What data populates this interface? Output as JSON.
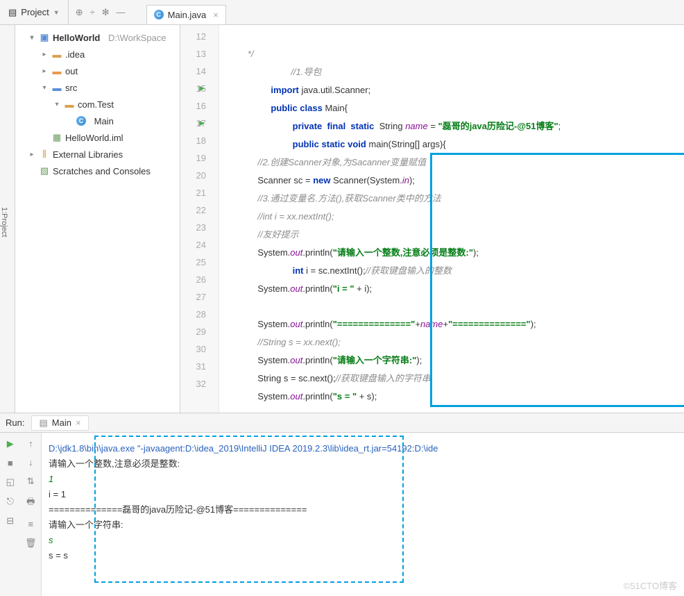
{
  "toolbar": {
    "project_label": "Project",
    "file_tab": "Main.java"
  },
  "tree": {
    "root": "HelloWorld",
    "root_path": "D:\\WorkSpace",
    "idea": ".idea",
    "out": "out",
    "src": "src",
    "pkg": "com.Test",
    "main": "Main",
    "iml": "HelloWorld.iml",
    "ext": "External Libraries",
    "scratch": "Scratches and Consoles"
  },
  "code": {
    "lines": [
      "12",
      "13",
      "14",
      "15",
      "16",
      "17",
      "18",
      "19",
      "20",
      "21",
      "22",
      "23",
      "24",
      "25",
      "26",
      "27",
      "28",
      "29",
      "30",
      "31",
      "32"
    ],
    "l12": "        */",
    "l13": "        //1.导包",
    "l14_a": "import",
    "l14_b": " java.util.Scanner;",
    "l15_a": "public class",
    "l15_b": " Main{",
    "l16_a": "private  final  static",
    "l16_b": "  String ",
    "l16_c": "name",
    "l16_d": " = ",
    "l16_e": "\"磊哥的java历险记-@51博客\"",
    "l16_f": ";",
    "l17_a": "public static void",
    "l17_b": " main(String[] args){",
    "l18": "            //2.创建Scanner对象,为Sacanner变量赋值",
    "l19_a": "            Scanner sc = ",
    "l19_b": "new",
    "l19_c": " Scanner(System.",
    "l19_d": "in",
    "l19_e": ");",
    "l20": "            //3.通过变量名.方法(),获取Scanner类中的方法",
    "l21": "            //int i = xx.nextInt();",
    "l22": "            //友好提示",
    "l23_a": "            System.",
    "l23_b": "out",
    "l23_c": ".println(",
    "l23_d": "\"请输入一个整数,注意必须是整数:\"",
    "l23_e": ");",
    "l24_a": "int",
    "l24_b": " i = sc.nextInt();",
    "l24_c": "//获取键盘输入的整数",
    "l25_a": "            System.",
    "l25_b": "out",
    "l25_c": ".println(",
    "l25_d": "\"i = \"",
    "l25_e": " + i);",
    "l27_a": "            System.",
    "l27_b": "out",
    "l27_c": ".println(",
    "l27_d": "\"==============\"",
    "l27_e": "+",
    "l27_f": "name",
    "l27_g": "+",
    "l27_h": "\"==============\"",
    "l27_i": ");",
    "l28": "            //String s = xx.next();",
    "l29_a": "            System.",
    "l29_b": "out",
    "l29_c": ".println(",
    "l29_d": "\"请输入一个字符串:\"",
    "l29_e": ");",
    "l30_a": "            String s = sc.next();",
    "l30_b": "//获取键盘输入的字符串",
    "l31_a": "            System.",
    "l31_b": "out",
    "l31_c": ".println(",
    "l31_d": "\"s = \"",
    "l31_e": " + s);"
  },
  "run": {
    "label": "Run:",
    "tab": "Main",
    "cmd": "D:\\jdk1.8\\bin\\java.exe \"-javaagent:D:\\idea_2019\\IntelliJ IDEA 2019.2.3\\lib\\idea_rt.jar=54192:D:\\ide",
    "l1": "请输入一个整数,注意必须是整数:",
    "l2": "1",
    "l3": "i = 1",
    "l4": "==============磊哥的java历险记-@51博客==============",
    "l5": "请输入一个字符串:",
    "l6": "s",
    "l7": "s = s"
  },
  "watermark": "©51CTO博客"
}
